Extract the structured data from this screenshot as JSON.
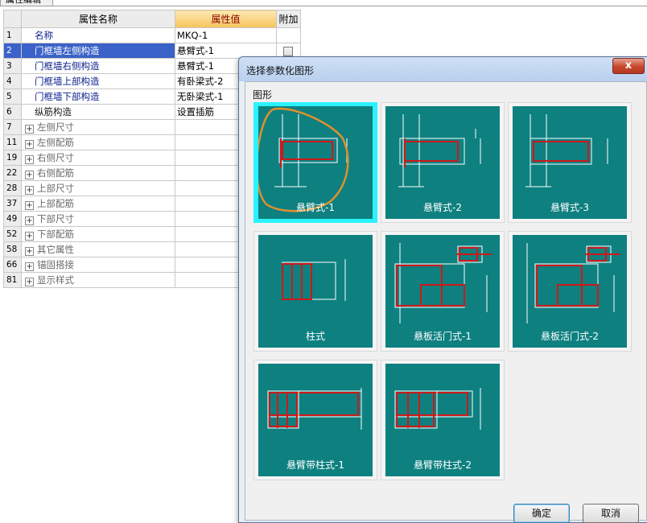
{
  "top_tab": {
    "label": "属性编辑"
  },
  "grid": {
    "headers": {
      "num": "",
      "name": "属性名称",
      "value": "属性值",
      "extra": "附加"
    },
    "rows": [
      {
        "num": "1",
        "name": "名称",
        "value": "MKQ-1",
        "type": "item"
      },
      {
        "num": "2",
        "name": "门框墙左侧构造",
        "value": "悬臂式-1",
        "type": "item",
        "selected": true,
        "checkbox": true
      },
      {
        "num": "3",
        "name": "门框墙右侧构造",
        "value": "悬臂式-1",
        "type": "item"
      },
      {
        "num": "4",
        "name": "门框墙上部构造",
        "value": "有卧梁式-2",
        "type": "item"
      },
      {
        "num": "5",
        "name": "门框墙下部构造",
        "value": "无卧梁式-1",
        "type": "item"
      },
      {
        "num": "6",
        "name": "纵筋构造",
        "value": "设置插筋",
        "type": "item-black"
      },
      {
        "num": "7",
        "name": "左侧尺寸",
        "value": "",
        "type": "group"
      },
      {
        "num": "11",
        "name": "左侧配筋",
        "value": "",
        "type": "group"
      },
      {
        "num": "19",
        "name": "右侧尺寸",
        "value": "",
        "type": "group"
      },
      {
        "num": "22",
        "name": "右侧配筋",
        "value": "",
        "type": "group"
      },
      {
        "num": "28",
        "name": "上部尺寸",
        "value": "",
        "type": "group"
      },
      {
        "num": "37",
        "name": "上部配筋",
        "value": "",
        "type": "group"
      },
      {
        "num": "49",
        "name": "下部尺寸",
        "value": "",
        "type": "group"
      },
      {
        "num": "52",
        "name": "下部配筋",
        "value": "",
        "type": "group"
      },
      {
        "num": "58",
        "name": "其它属性",
        "value": "",
        "type": "group"
      },
      {
        "num": "66",
        "name": "锚固搭接",
        "value": "",
        "type": "group"
      },
      {
        "num": "81",
        "name": "显示样式",
        "value": "",
        "type": "group"
      }
    ]
  },
  "dialog": {
    "title": "选择参数化图形",
    "close_symbol": "x",
    "group_label": "图形",
    "shapes": [
      {
        "label": "悬臂式-1",
        "kind": "cantilever1",
        "selected": true
      },
      {
        "label": "悬臂式-2",
        "kind": "cantilever2"
      },
      {
        "label": "悬臂式-3",
        "kind": "cantilever3"
      },
      {
        "label": "柱式",
        "kind": "column"
      },
      {
        "label": "悬板活门式-1",
        "kind": "slab1"
      },
      {
        "label": "悬板活门式-2",
        "kind": "slab2"
      },
      {
        "label": "悬臂带柱式-1",
        "kind": "cantcol1"
      },
      {
        "label": "悬臂带柱式-2",
        "kind": "cantcol2"
      }
    ],
    "ok_label": "确定",
    "cancel_label": "取消"
  },
  "colors": {
    "thumb_bg": "#0e8080",
    "selected_cell": "#2af3ff",
    "rebar_red": "#d01818",
    "annotation_orange": "#e0902c"
  }
}
